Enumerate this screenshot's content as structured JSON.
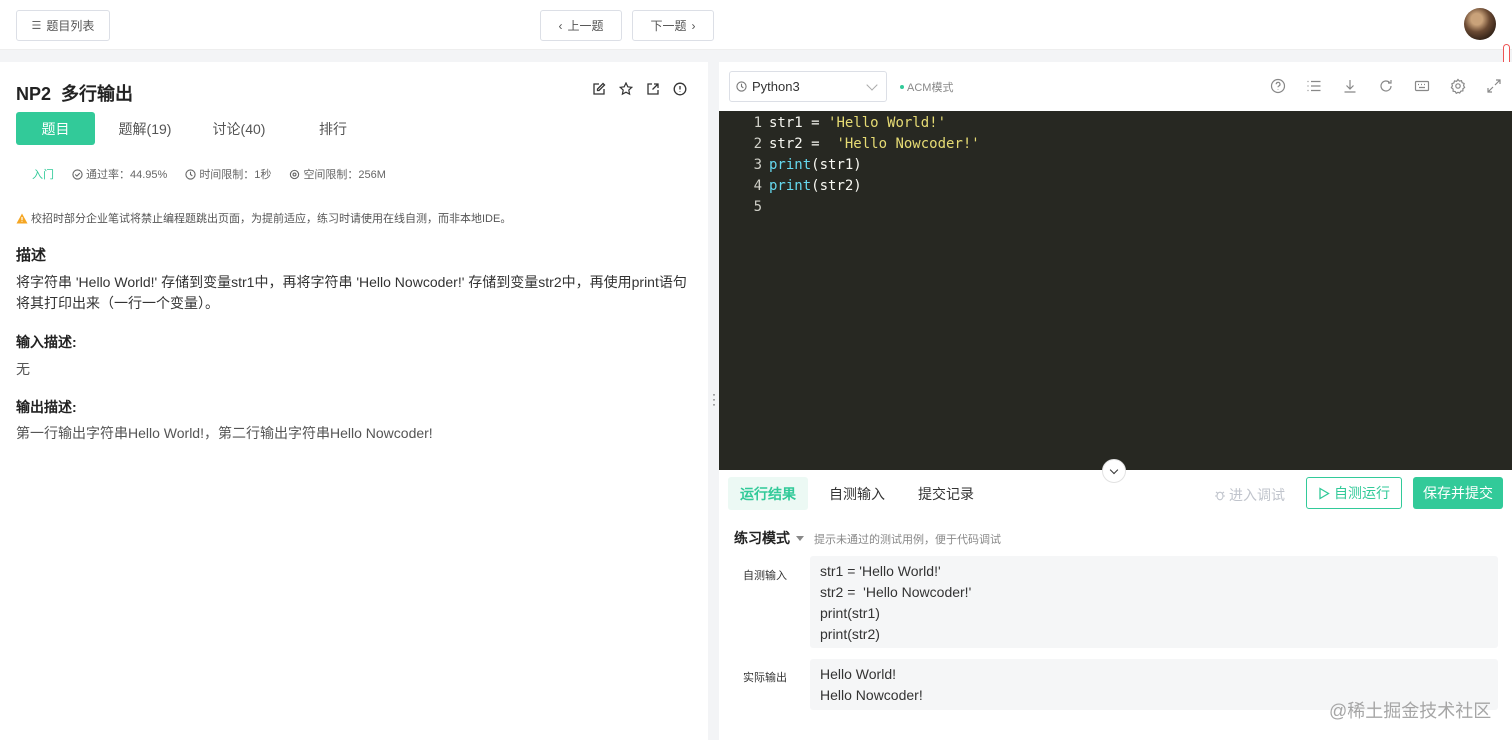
{
  "topbar": {
    "problem_list_label": "题目列表",
    "prev_label": "上一题",
    "next_label": "下一题"
  },
  "problem": {
    "title": "NP2  多行输出",
    "tabs": [
      "题目",
      "题解(19)",
      "讨论(40)",
      "排行"
    ],
    "meta": {
      "level": "入门",
      "pass_rate": "通过率：44.95%",
      "time_limit": "时间限制：1秒",
      "space_limit": "空间限制：256M"
    },
    "warning": "校招时部分企业笔试将禁止编程题跳出页面，为提前适应，练习时请使用在线自测，而非本地IDE。",
    "desc_heading": "描述",
    "desc_text": "将字符串 'Hello World!' 存储到变量str1中，再将字符串 'Hello Nowcoder!' 存储到变量str2中，再使用print语句将其打印出来（一行一个变量）。",
    "input_heading": "输入描述:",
    "input_text": "无",
    "output_heading": "输出描述:",
    "output_text": "第一行输出字符串Hello World!，第二行输出字符串Hello Nowcoder!"
  },
  "editor": {
    "language": "Python3",
    "mode": "ACM模式",
    "code_lines": [
      {
        "no": "1",
        "a": "str1 = ",
        "str": "'Hello World!'",
        "fn": "",
        "rest": ""
      },
      {
        "no": "2",
        "a": "str2 =  ",
        "str": "'Hello Nowcoder!'",
        "fn": "",
        "rest": ""
      },
      {
        "no": "3",
        "a": "",
        "str": "",
        "fn": "print",
        "rest": "(str1)"
      },
      {
        "no": "4",
        "a": "",
        "str": "",
        "fn": "print",
        "rest": "(str2)"
      },
      {
        "no": "5",
        "a": "",
        "str": "",
        "fn": "",
        "rest": ""
      }
    ]
  },
  "result": {
    "tabs": [
      "运行结果",
      "自测输入",
      "提交记录"
    ],
    "debug_label": "进入调试",
    "run_label": "自测运行",
    "submit_label": "保存并提交",
    "practice_mode": "练习模式",
    "practice_hint": "提示未通过的测试用例，便于代码调试",
    "self_input_label": "自测输入",
    "self_input_lines": [
      "str1 = 'Hello World!'",
      "str2 =  'Hello Nowcoder!'",
      "print(str1)",
      "print(str2)"
    ],
    "actual_output_label": "实际输出",
    "actual_output_lines": [
      "Hello World!",
      "Hello Nowcoder!"
    ]
  },
  "watermark": "@稀土掘金技术社区",
  "colors": {
    "accent": "#32ca99",
    "editor_bg": "#272822",
    "string": "#e6db74",
    "keyword": "#66d9ef"
  }
}
